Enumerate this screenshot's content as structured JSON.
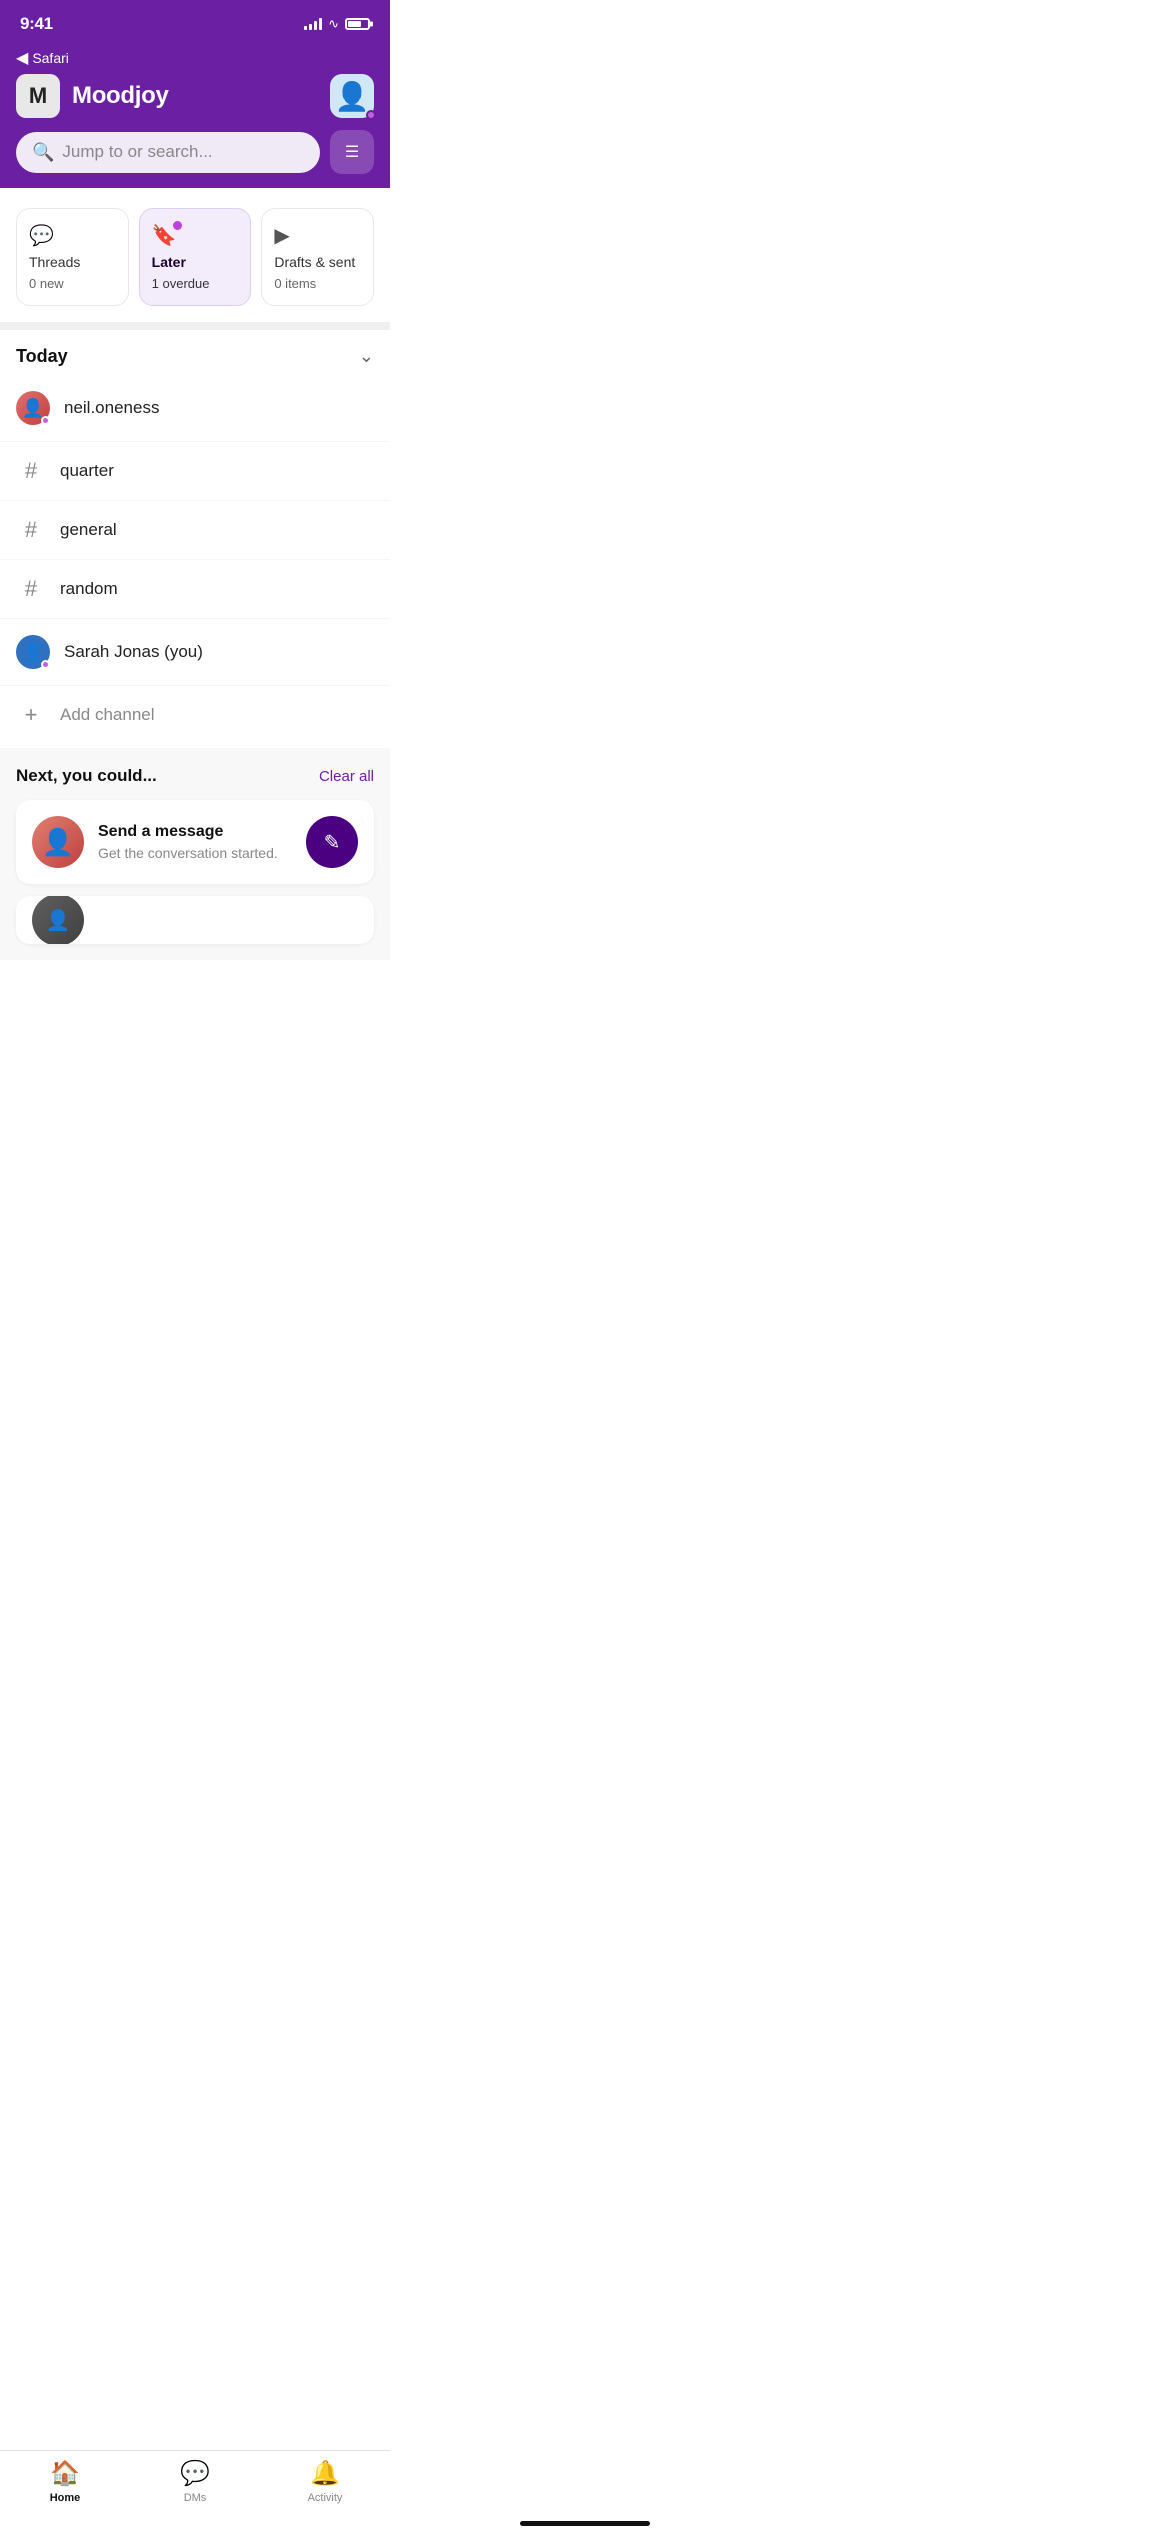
{
  "statusBar": {
    "time": "9:41",
    "backLabel": "Safari"
  },
  "header": {
    "appLogo": "M",
    "appName": "Moodjoy",
    "searchPlaceholder": "Jump to or search..."
  },
  "quickCards": [
    {
      "id": "threads",
      "label": "Threads",
      "sublabel": "0 new",
      "active": false,
      "hasDot": false
    },
    {
      "id": "later",
      "label": "Later",
      "sublabel": "1 overdue",
      "active": true,
      "hasDot": true
    },
    {
      "id": "drafts",
      "label": "Drafts & sent",
      "sublabel": "0 items",
      "active": false,
      "hasDot": false
    }
  ],
  "todaySection": {
    "title": "Today"
  },
  "channels": [
    {
      "type": "dm",
      "name": "neil.oneness"
    },
    {
      "type": "channel",
      "name": "quarter"
    },
    {
      "type": "channel",
      "name": "general"
    },
    {
      "type": "channel",
      "name": "random"
    },
    {
      "type": "self",
      "name": "Sarah Jonas (you)"
    },
    {
      "type": "add",
      "name": "Add channel"
    }
  ],
  "nextSection": {
    "title": "Next, you could...",
    "clearAll": "Clear all",
    "suggestions": [
      {
        "title": "Send a message",
        "desc": "Get the conversation started."
      }
    ]
  },
  "tabBar": {
    "tabs": [
      {
        "id": "home",
        "label": "Home",
        "active": true
      },
      {
        "id": "dms",
        "label": "DMs",
        "active": false
      },
      {
        "id": "activity",
        "label": "Activity",
        "active": false
      }
    ]
  }
}
